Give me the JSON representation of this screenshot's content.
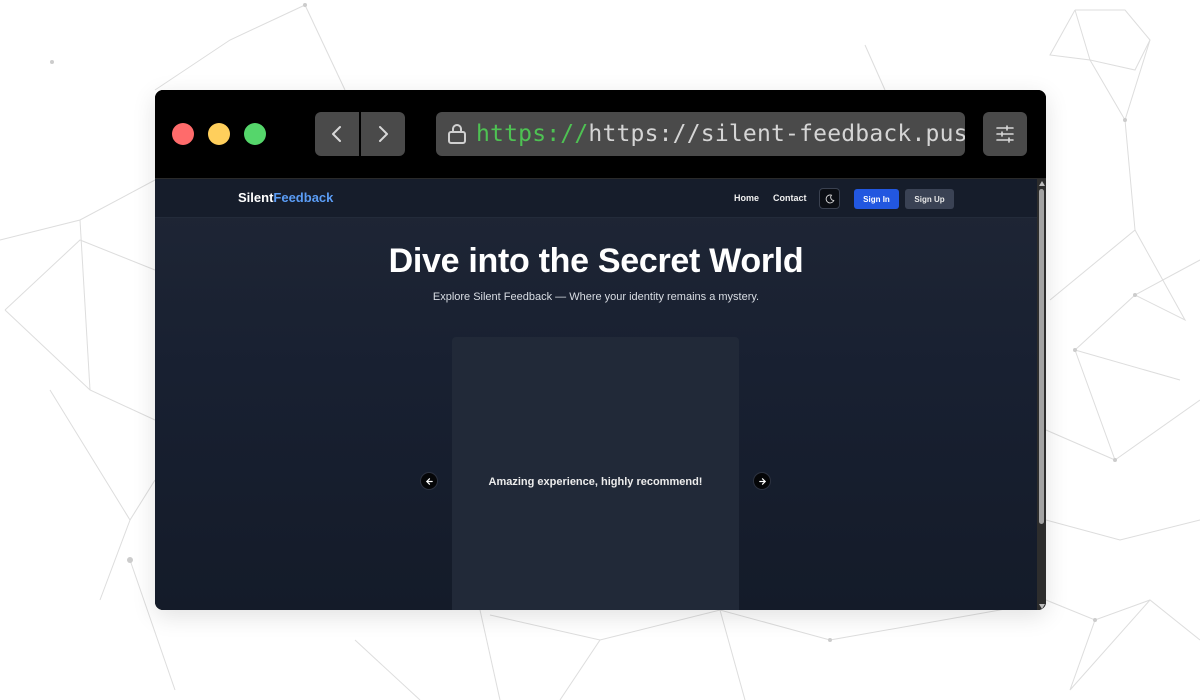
{
  "browser": {
    "url_scheme": "https://",
    "url_rest": "https://silent-feedback.push",
    "icons": {
      "back": "chevron-left-icon",
      "forward": "chevron-right-icon",
      "lock": "lock-icon",
      "settings": "sliders-icon"
    },
    "traffic_lights": [
      "#ff6b6b",
      "#ffcf5c",
      "#55d66b"
    ]
  },
  "site": {
    "logo_primary": "Silent",
    "logo_accent": "Feedback",
    "nav": {
      "home": "Home",
      "contact": "Contact",
      "theme_icon": "moon-icon",
      "sign_in": "Sign In",
      "sign_up": "Sign Up"
    },
    "hero": {
      "title": "Dive into the Secret World",
      "subtitle": "Explore Silent Feedback — Where your identity remains a mystery."
    },
    "carousel": {
      "message": "Amazing experience, highly recommend!",
      "prev_icon": "arrow-left-icon",
      "next_icon": "arrow-right-icon"
    }
  },
  "colors": {
    "accent": "#5a9cf5",
    "sign_in_bg": "#2257e0",
    "page_bg": "#1b2231",
    "url_scheme": "#4ec253"
  }
}
